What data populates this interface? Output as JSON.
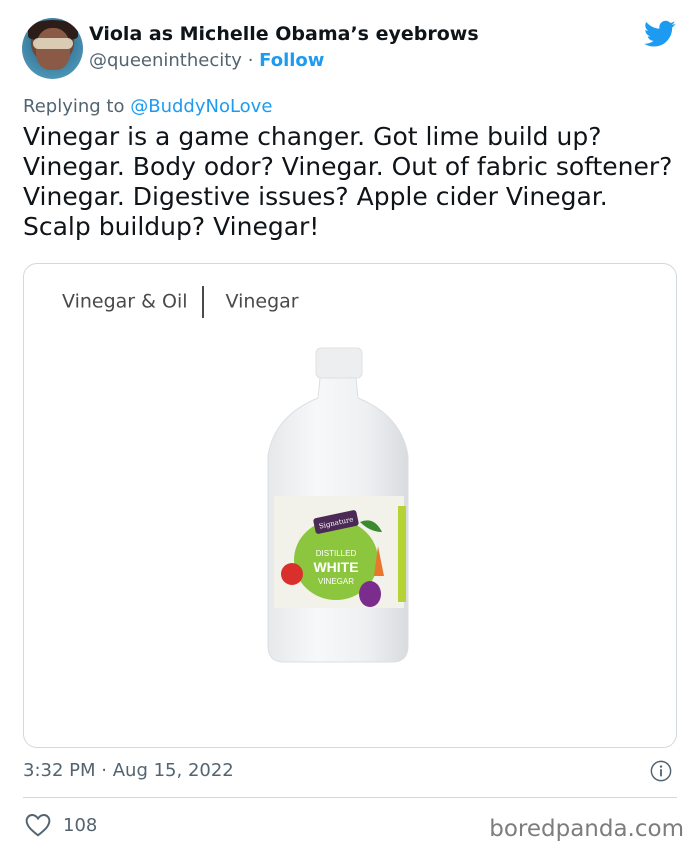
{
  "author": {
    "display_name": "Viola as Michelle Obama’s eyebrows",
    "handle": "@queeninthecity",
    "separator": "·",
    "follow_label": "Follow"
  },
  "reply": {
    "prefix": "Replying to",
    "mention": "@BuddyNoLove"
  },
  "tweet": {
    "text": "Vinegar is a game changer. Got lime build up? Vinegar. Body odor? Vinegar. Out of fabric softener? Vinegar. Digestive issues? Apple cider Vinegar. Scalp buildup? Vinegar!"
  },
  "card": {
    "breadcrumb": [
      "Vinegar & Oil",
      "Vinegar"
    ],
    "label_brand": "Signature",
    "label_line1": "DISTILLED",
    "label_line2": "WHITE",
    "label_line3": "VINEGAR"
  },
  "meta": {
    "time": "3:32 PM",
    "separator": "·",
    "date": "Aug 15, 2022"
  },
  "engagement": {
    "likes": "108"
  },
  "watermark": "boredpanda.com",
  "icons": {
    "platform": "twitter-bird-icon",
    "info": "info-icon",
    "like": "heart-icon"
  },
  "colors": {
    "accent": "#1d9bf0",
    "secondary_text": "#536471",
    "border": "#cfd9de"
  }
}
